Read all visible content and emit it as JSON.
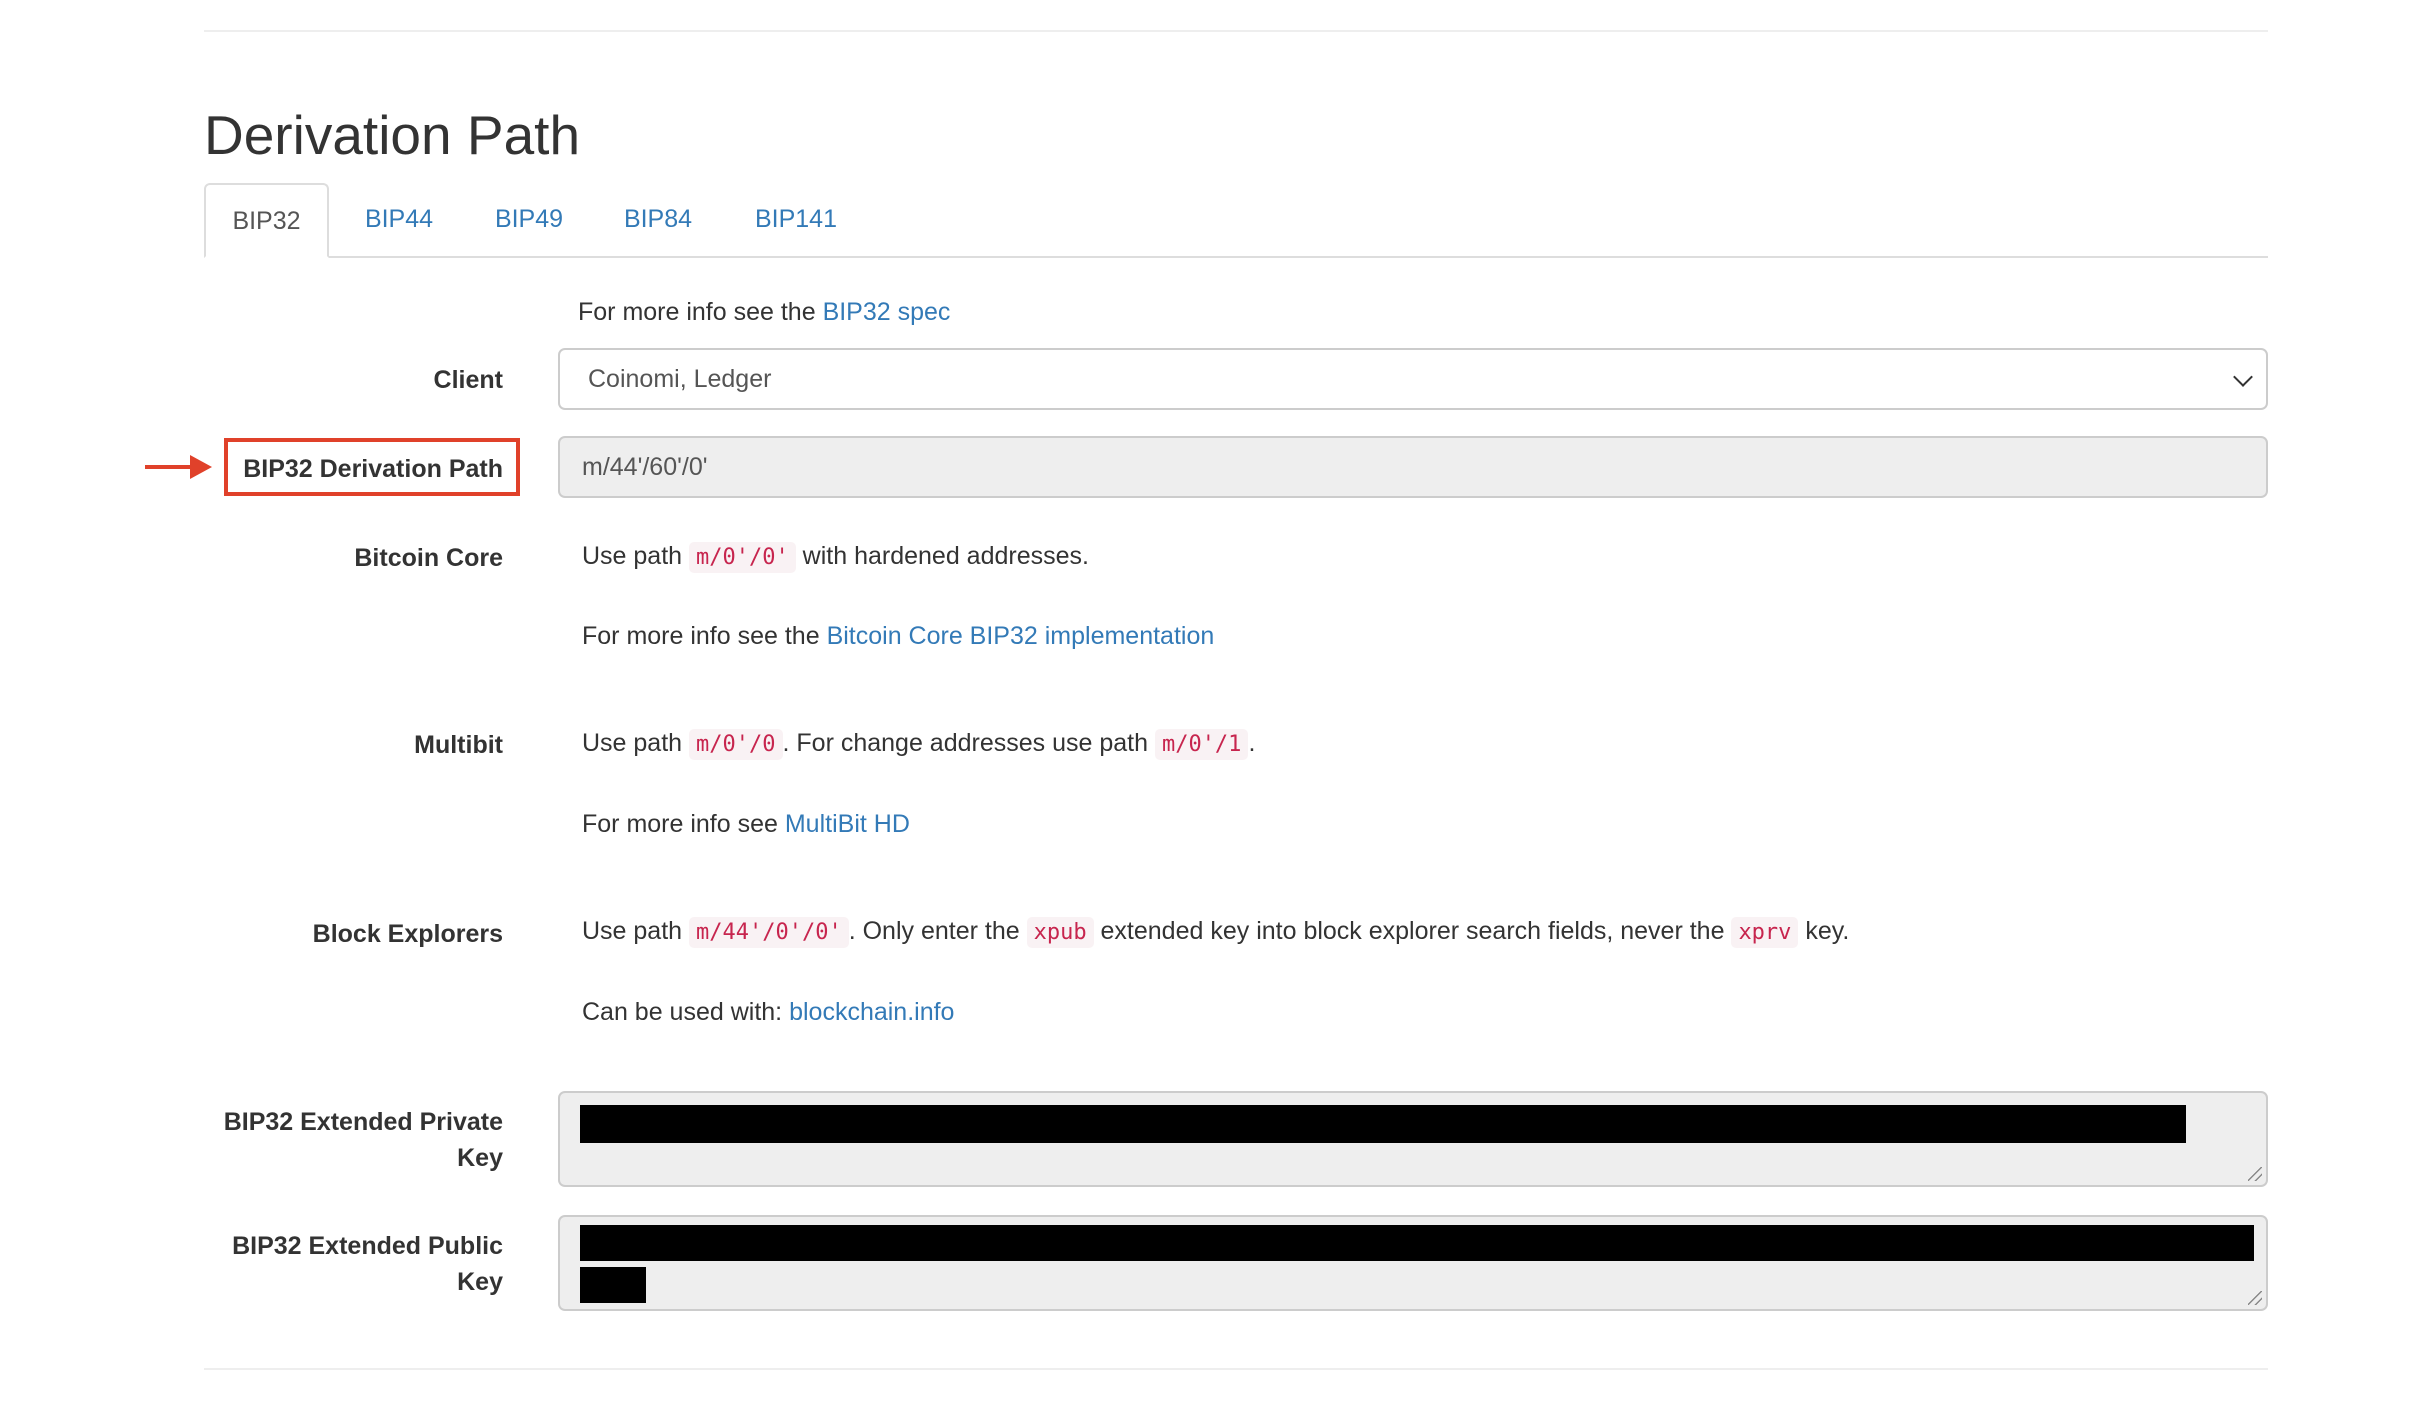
{
  "page": {
    "title": "Derivation Path"
  },
  "tabs": [
    {
      "label": "BIP32",
      "active": true
    },
    {
      "label": "BIP44",
      "active": false
    },
    {
      "label": "BIP49",
      "active": false
    },
    {
      "label": "BIP84",
      "active": false
    },
    {
      "label": "BIP141",
      "active": false
    }
  ],
  "bip32": {
    "info_prefix": "For more info see the ",
    "info_link": "BIP32 spec",
    "client_label": "Client",
    "client_value": "Coinomi, Ledger",
    "path_label": "BIP32 Derivation Path",
    "path_value": "m/44'/60'/0'",
    "bitcoin_core": {
      "label": "Bitcoin Core",
      "line1_pre": "Use path ",
      "line1_code": "m/0'/0'",
      "line1_post": " with hardened addresses.",
      "line2_pre": "For more info see the ",
      "line2_link": "Bitcoin Core BIP32 implementation"
    },
    "multibit": {
      "label": "Multibit",
      "line1_pre": "Use path ",
      "line1_code1": "m/0'/0",
      "line1_mid": ". For change addresses use path ",
      "line1_code2": "m/0'/1",
      "line1_post": ".",
      "line2_pre": "For more info see ",
      "line2_link": "MultiBit HD"
    },
    "block_explorers": {
      "label": "Block Explorers",
      "line1_pre": "Use path ",
      "line1_code1": "m/44'/0'/0'",
      "line1_mid1": ". Only enter the ",
      "line1_code2": "xpub",
      "line1_mid2": " extended key into block explorer search fields, never the ",
      "line1_code3": "xprv",
      "line1_post": " key.",
      "line2_pre": "Can be used with: ",
      "line2_link": "blockchain.info"
    },
    "ext_private_label_1": "BIP32 Extended Private",
    "ext_private_label_2": "Key",
    "ext_public_label_1": "BIP32 Extended Public",
    "ext_public_label_2": "Key"
  },
  "colors": {
    "link": "#337ab7",
    "annotation": "#e0412a",
    "code_text": "#c7254e",
    "code_bg": "#f9f2f4",
    "readonly_bg": "#eeeeee"
  }
}
